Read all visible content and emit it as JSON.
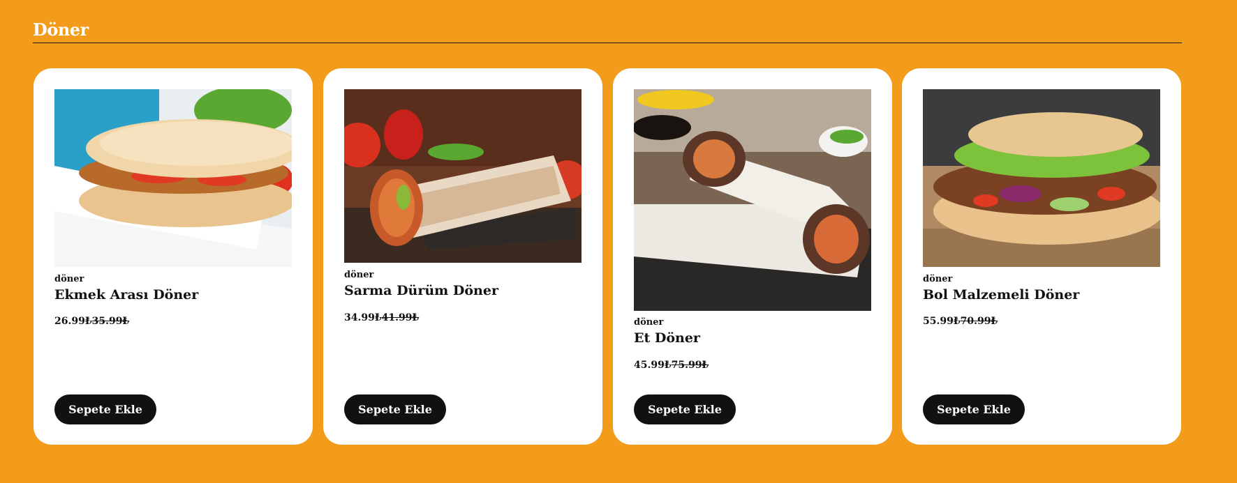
{
  "section": {
    "title": "Döner"
  },
  "products": [
    {
      "category": "döner",
      "name": "Ekmek Arası Döner",
      "price": "26.99₺",
      "old_price": "35.99₺",
      "button": "Sepete Ekle",
      "image": "sandwich-doner-image"
    },
    {
      "category": "döner",
      "name": "Sarma Dürüm Döner",
      "price": "34.99₺",
      "old_price": "41.99₺",
      "button": "Sepete Ekle",
      "image": "durum-wrap-image"
    },
    {
      "category": "döner",
      "name": "Et Döner",
      "price": "45.99₺",
      "old_price": "75.99₺",
      "button": "Sepete Ekle",
      "image": "meat-wrap-image"
    },
    {
      "category": "döner",
      "name": "Bol Malzemeli Döner",
      "price": "55.99₺",
      "old_price": "70.99₺",
      "button": "Sepete Ekle",
      "image": "loaded-pita-doner-image"
    }
  ],
  "colors": {
    "background": "#f39c1c",
    "card": "#ffffff",
    "button": "#111111",
    "button_text": "#ffffff"
  }
}
